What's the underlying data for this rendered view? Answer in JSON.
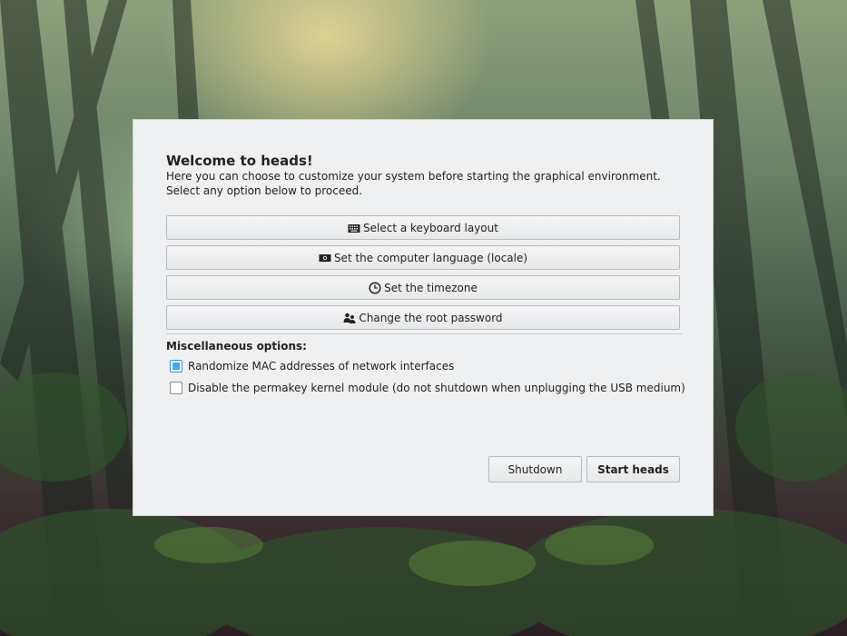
{
  "dialog": {
    "title": "Welcome to heads!",
    "description_line1": "Here you can choose to customize your system before starting the graphical environment.",
    "description_line2": "Select any option below to proceed.",
    "options": [
      {
        "label": "Select a keyboard layout",
        "icon": "keyboard-icon"
      },
      {
        "label": "Set the computer language (locale)",
        "icon": "flag-icon"
      },
      {
        "label": "Set the timezone",
        "icon": "clock-icon"
      },
      {
        "label": "Change the root password",
        "icon": "users-icon"
      }
    ],
    "misc_heading": "Miscellaneous options:",
    "checkboxes": [
      {
        "label": "Randomize MAC addresses of network interfaces",
        "checked": true
      },
      {
        "label": "Disable the permakey kernel module (do not shutdown when unplugging the USB medium)",
        "checked": false
      }
    ],
    "shutdown_label": "Shutdown",
    "start_label": "Start heads"
  },
  "colors": {
    "accent": "#3daee9",
    "dialog_bg": "#eff0f1"
  }
}
